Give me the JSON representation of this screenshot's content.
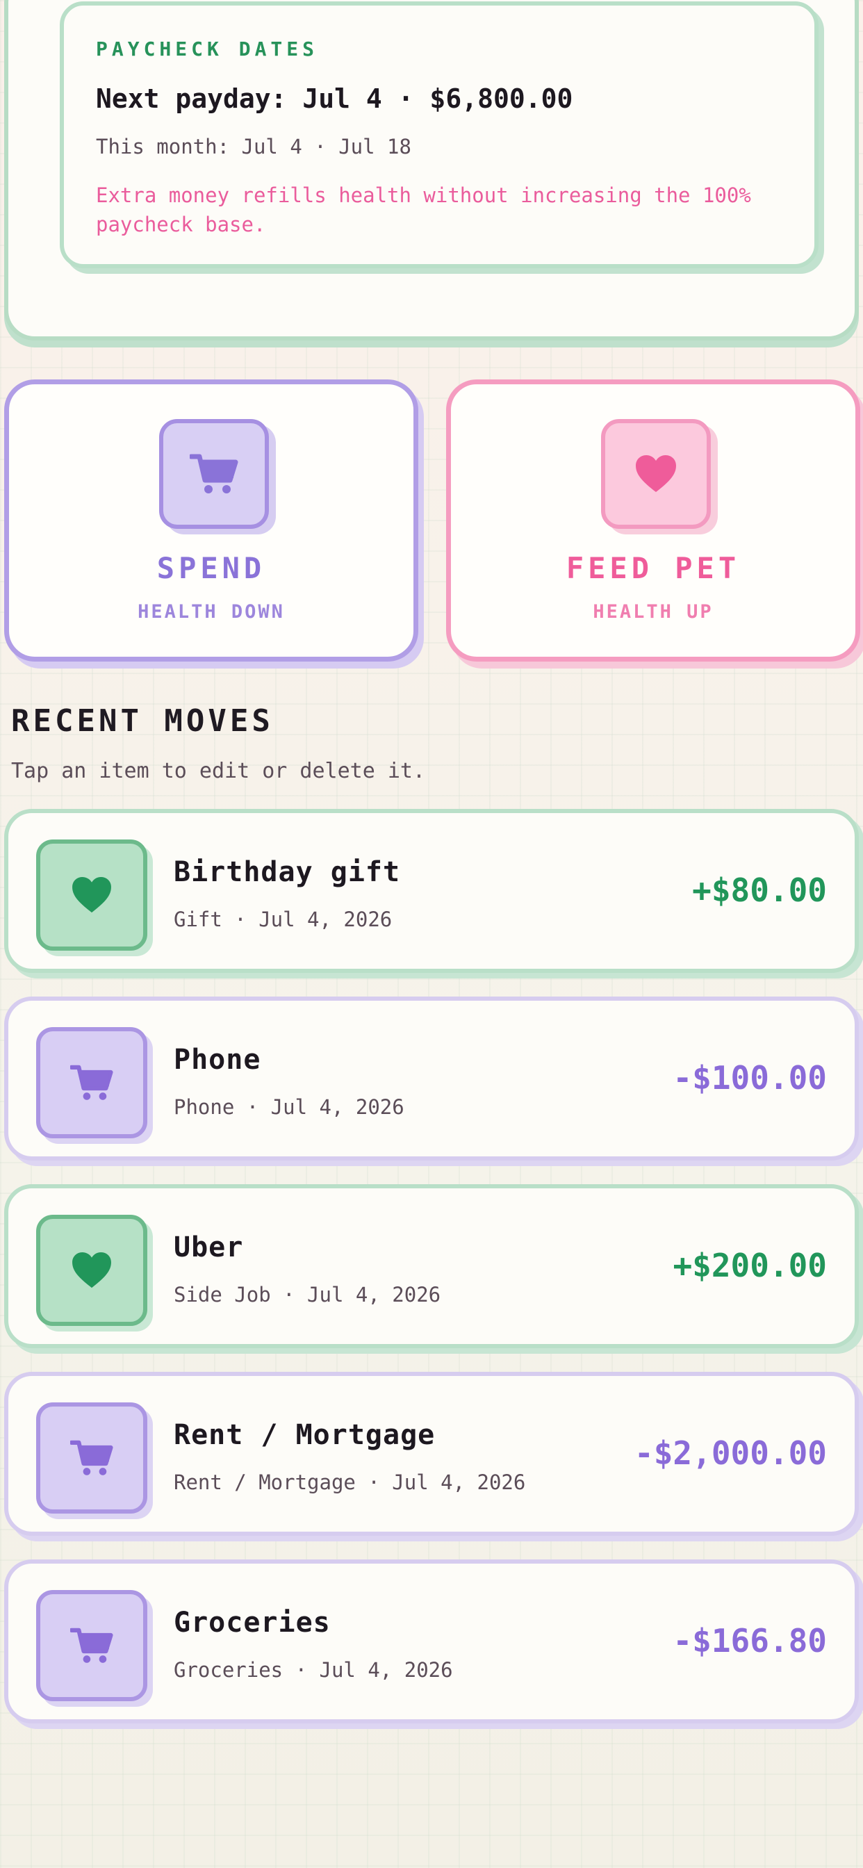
{
  "paycheck": {
    "eyebrow": "PAYCHECK DATES",
    "next": "Next payday: Jul 4 · $6,800.00",
    "month": "This month: Jul 4 · Jul 18",
    "note": "Extra money refills health without increasing the 100% paycheck base."
  },
  "actions": {
    "spend": {
      "title": "SPEND",
      "subtitle": "HEALTH DOWN",
      "icon": "cart-icon"
    },
    "feed": {
      "title": "FEED PET",
      "subtitle": "HEALTH UP",
      "icon": "heart-icon"
    }
  },
  "recent": {
    "title": "RECENT MOVES",
    "subtitle": "Tap an item to edit or delete it.",
    "items": [
      {
        "name": "Birthday gift",
        "meta": "Gift · Jul 4, 2026",
        "amount": "+$80.00",
        "kind": "income",
        "icon": "heart-icon"
      },
      {
        "name": "Phone",
        "meta": "Phone · Jul 4, 2026",
        "amount": "-$100.00",
        "kind": "expense",
        "icon": "cart-icon"
      },
      {
        "name": "Uber",
        "meta": "Side Job · Jul 4, 2026",
        "amount": "+$200.00",
        "kind": "income",
        "icon": "heart-icon"
      },
      {
        "name": "Rent / Mortgage",
        "meta": "Rent / Mortgage · Jul 4, 2026",
        "amount": "-$2,000.00",
        "kind": "expense",
        "icon": "cart-icon"
      },
      {
        "name": "Groceries",
        "meta": "Groceries · Jul 4, 2026",
        "amount": "-$166.80",
        "kind": "expense",
        "icon": "cart-icon"
      }
    ]
  },
  "colors": {
    "income": "#21965a",
    "expense": "#8a6bd8",
    "pink": "#ef5c9a",
    "green_border": "#b9dfc8",
    "purple_border": "#b19ee6"
  }
}
